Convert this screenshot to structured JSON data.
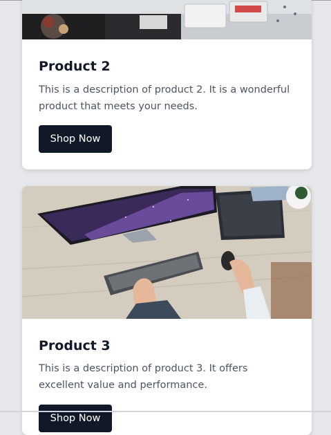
{
  "products": [
    {
      "title": "Product 2",
      "description": "This is a description of product 2. It is a wonderful product that meets your needs.",
      "button_label": "Shop Now",
      "image": "product-2-photo"
    },
    {
      "title": "Product 3",
      "description": "This is a description of product 3. It offers excellent value and performance.",
      "button_label": "Shop Now",
      "image": "product-3-photo"
    }
  ],
  "colors": {
    "page_bg": "#e5e7eb",
    "card_bg": "#ffffff",
    "button_bg": "#111827",
    "button_text": "#ffffff",
    "title_text": "#111827",
    "description_text": "#4b5563"
  }
}
